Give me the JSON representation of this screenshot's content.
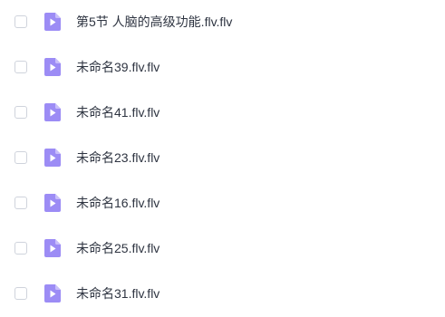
{
  "files": [
    {
      "name": "第5节 人脑的高级功能.flv.flv",
      "icon": "video-file-icon"
    },
    {
      "name": "未命名39.flv.flv",
      "icon": "video-file-icon"
    },
    {
      "name": "未命名41.flv.flv",
      "icon": "video-file-icon"
    },
    {
      "name": "未命名23.flv.flv",
      "icon": "video-file-icon"
    },
    {
      "name": "未命名16.flv.flv",
      "icon": "video-file-icon"
    },
    {
      "name": "未命名25.flv.flv",
      "icon": "video-file-icon"
    },
    {
      "name": "未命名31.flv.flv",
      "icon": "video-file-icon"
    }
  ],
  "colors": {
    "icon_body": "#9c8cf5",
    "icon_fold": "#c8befa",
    "icon_play": "#ffffff",
    "text": "#2e3441",
    "checkbox_border": "#cfd3dc"
  }
}
